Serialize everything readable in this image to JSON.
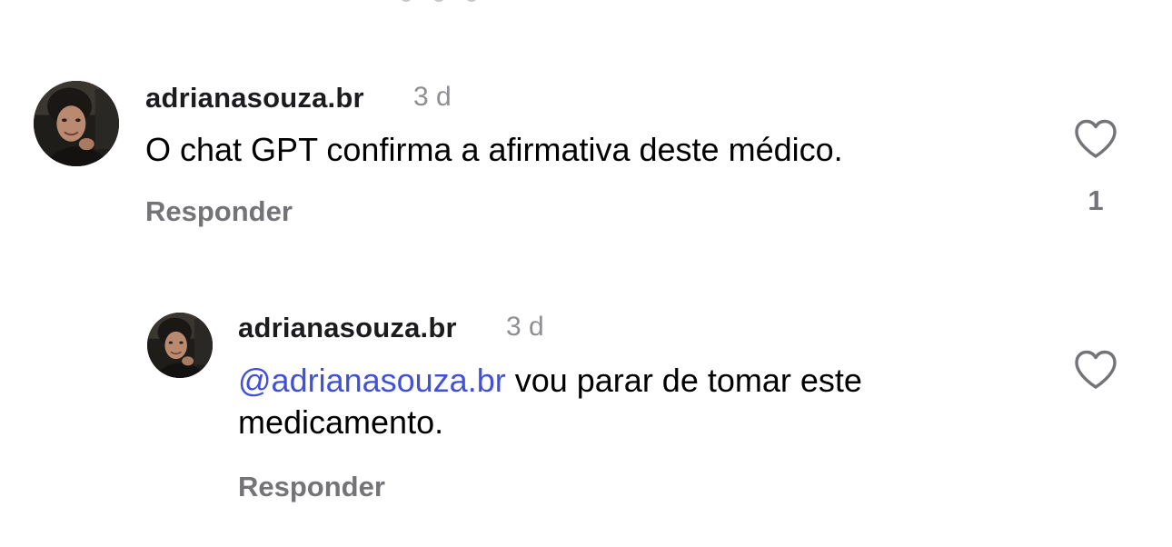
{
  "comments": [
    {
      "username": "adrianasouza.br",
      "time": "3 d",
      "text": "O chat GPT confirma a afirmativa deste médico.",
      "reply_label": "Responder",
      "like_count": "1"
    }
  ],
  "replies": [
    {
      "username": "adrianasouza.br",
      "time": "3 d",
      "mention": "@adrianasouza.br",
      "text": " vou parar de tomar este medicamento.",
      "reply_label": "Responder"
    }
  ],
  "icons": {
    "like": "heart-outline-icon"
  },
  "colors": {
    "mention": "#4150d8",
    "secondary_text": "#8e8e93",
    "reply_text": "#737378"
  }
}
